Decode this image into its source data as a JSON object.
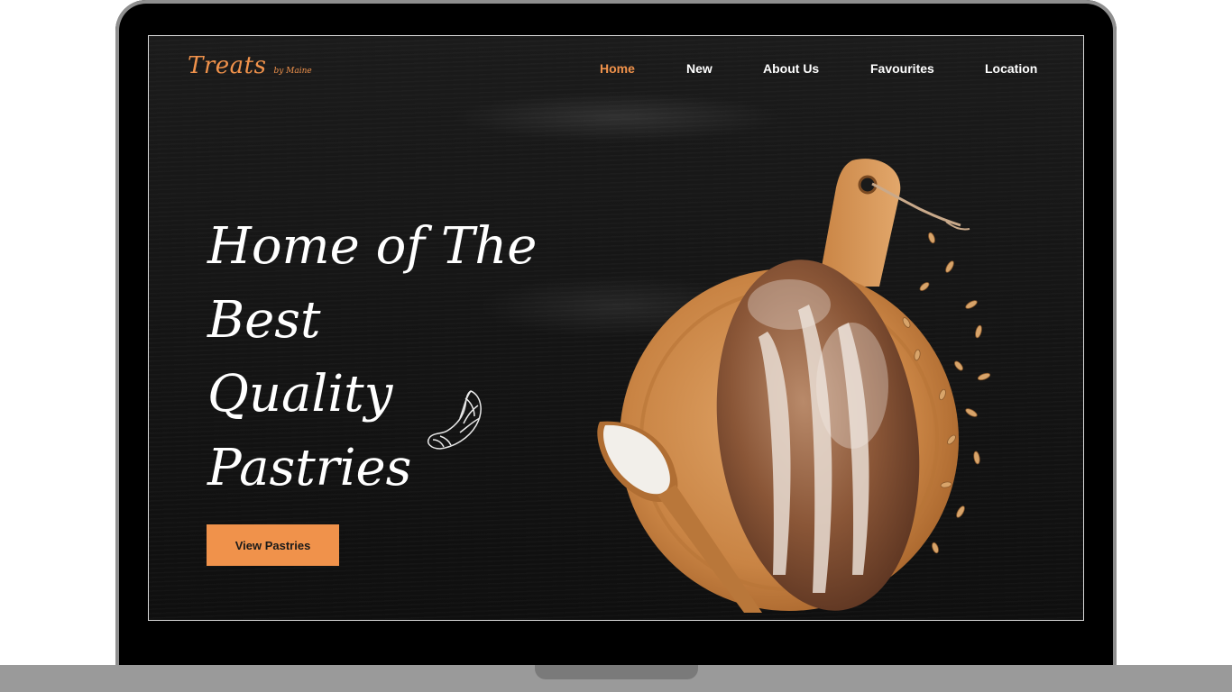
{
  "logo": {
    "main": "Treats",
    "sub": "by Maine"
  },
  "nav": {
    "items": [
      {
        "label": "Home",
        "active": true
      },
      {
        "label": "New",
        "active": false
      },
      {
        "label": "About Us",
        "active": false
      },
      {
        "label": "Favourites",
        "active": false
      },
      {
        "label": "Location",
        "active": false
      }
    ]
  },
  "hero": {
    "title_lines": [
      "Home of The",
      "Best",
      "Quality",
      "Pastries"
    ],
    "cta_label": "View Pastries"
  },
  "colors": {
    "accent": "#f0924b",
    "background": "#141414",
    "text": "#ffffff"
  },
  "icons": {
    "croissant": "croissant-sketch-icon",
    "bread_board": "bread-on-cutting-board-image"
  }
}
